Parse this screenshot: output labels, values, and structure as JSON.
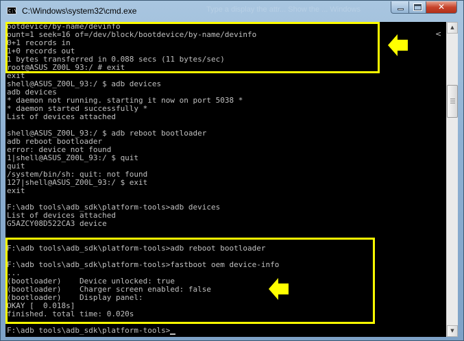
{
  "window": {
    "title": "C:\\Windows\\system32\\cmd.exe",
    "icon_text": "C:\\",
    "background_hint_text": "Type a display the attr...  Show the   ... Windows",
    "controls": {
      "minimize_icon": "minimize-icon",
      "maximize_icon": "maximize-icon",
      "close_label": "✕"
    }
  },
  "console": {
    "chevron": "<",
    "lines": [
      "ootdevice/by-name/devinfo",
      "ount=1 seek=16 of=/dev/block/bootdevice/by-name/devinfo",
      "0+1 records in",
      "1+0 records out",
      "1 bytes transferred in 0.088 secs (11 bytes/sec)",
      "root@ASUS_Z00L_93:/ # exit",
      "exit",
      "shell@ASUS_Z00L_93:/ $ adb devices",
      "adb devices",
      "* daemon not running. starting it now on port 5038 *",
      "* daemon started successfully *",
      "List of devices attached",
      "",
      "shell@ASUS_Z00L_93:/ $ adb reboot bootloader",
      "adb reboot bootloader",
      "error: device not found",
      "1|shell@ASUS_Z00L_93:/ $ quit",
      "quit",
      "/system/bin/sh: quit: not found",
      "127|shell@ASUS_Z00L_93:/ $ exit",
      "exit",
      "",
      "F:\\adb tools\\adb_sdk\\platform-tools>adb devices",
      "List of devices attached",
      "G5AZCY08D522CA3 device",
      "",
      "",
      "F:\\adb tools\\adb_sdk\\platform-tools>adb reboot bootloader",
      "",
      "F:\\adb tools\\adb_sdk\\platform-tools>fastboot oem device-info",
      "...",
      "(bootloader)    Device unlocked: true",
      "(bootloader)    Charger screen enabled: false",
      "(bootloader)    Display panel:",
      "OKAY [  0.018s]",
      "finished. total time: 0.020s",
      "",
      "F:\\adb tools\\adb_sdk\\platform-tools>"
    ]
  },
  "colors": {
    "console_bg": "#000000",
    "console_text": "#c0c0c0",
    "highlight": "#ffff00",
    "arrow_fill": "#ffff00"
  }
}
